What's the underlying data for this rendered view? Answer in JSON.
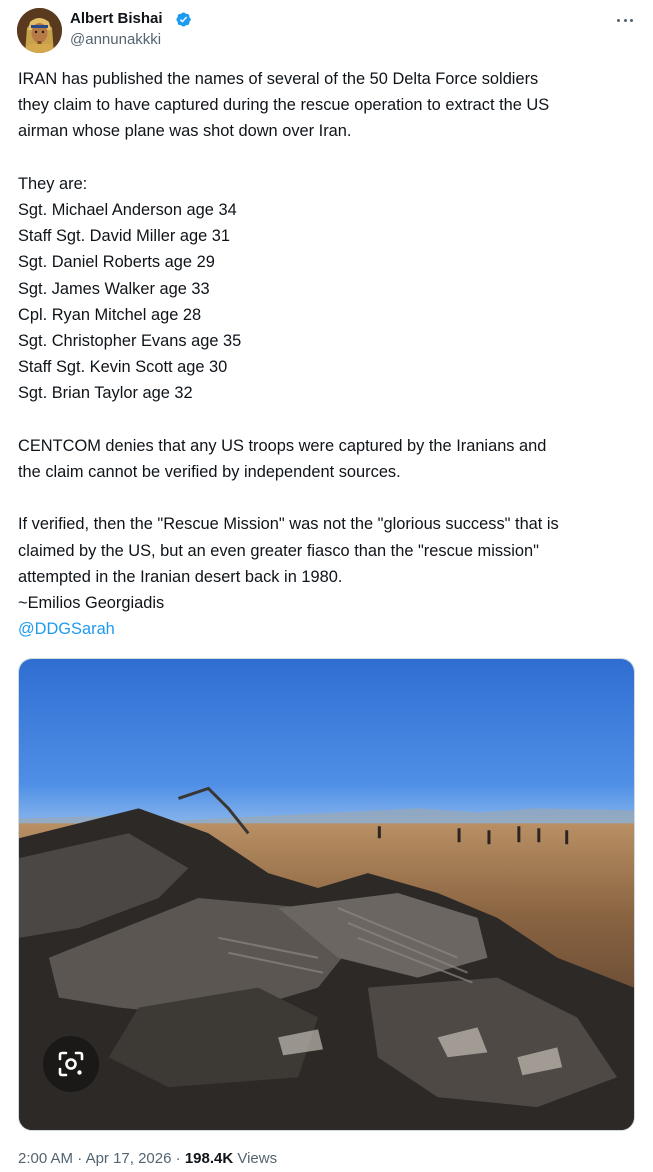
{
  "author": {
    "display_name": "Albert Bishai",
    "handle": "@annunakkki",
    "verified": true,
    "avatar_icon": "avatar-pharaoh"
  },
  "more_icon": "more-options-icon",
  "tweet": {
    "lines": [
      "IRAN has published the names of several of the 50 Delta Force soldiers",
      "they claim to have captured during the rescue operation to extract the US",
      "airman whose plane was shot down over Iran.",
      "",
      "They are:",
      "Sgt. Michael Anderson age 34",
      "Staff Sgt. David Miller age 31",
      "Sgt. Daniel Roberts age 29",
      "Sgt. James Walker age 33",
      "Cpl. Ryan Mitchel age 28",
      "Sgt. Christopher Evans age 35",
      "Staff Sgt. Kevin Scott age 30",
      "Sgt. Brian Taylor age 32",
      "",
      "CENTCOM denies that any US troops were captured by the Iranians and",
      "the claim cannot be verified by independent sources.",
      "",
      "If verified, then the \"Rescue Mission\" was not the \"glorious success\" that is",
      "claimed by the US, but an even greater fiasco than the \"rescue mission\"",
      "attempted in the Iranian desert back in 1980.",
      "~Emilios Georgiadis"
    ],
    "mention": "@DDGSarah"
  },
  "media": {
    "description_icon": "aircraft-wreckage-photo",
    "lens_icon": "google-lens-icon"
  },
  "meta": {
    "time": "2:00 AM",
    "separator": " · ",
    "date": "Apr 17, 2026",
    "views_count": "198.4K",
    "views_label": "Views"
  },
  "colors": {
    "link": "#1d9bf0",
    "verified": "#1d9bf0",
    "secondary_text": "#536471",
    "primary_text": "#0f1419"
  }
}
